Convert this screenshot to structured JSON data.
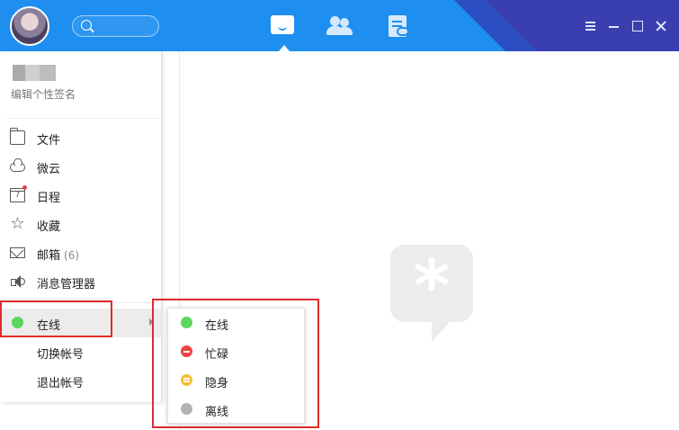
{
  "titlebar": {
    "search_placeholder": "",
    "tabs": [
      {
        "icon": "message-icon",
        "active": true
      },
      {
        "icon": "contacts-icon",
        "active": false
      },
      {
        "icon": "docs-icon",
        "active": false
      }
    ],
    "window_controls": [
      "menu-icon",
      "minimize-icon",
      "maximize-icon",
      "close-icon"
    ]
  },
  "menu": {
    "signature": "编辑个性签名",
    "items": [
      {
        "label": "文件",
        "icon": "folder-icon"
      },
      {
        "label": "微云",
        "icon": "cloud-icon"
      },
      {
        "label": "日程",
        "icon": "calendar-icon",
        "calendar_day": "7",
        "has_badge": true
      },
      {
        "label": "收藏",
        "icon": "star-icon"
      },
      {
        "label": "邮箱",
        "icon": "mail-icon",
        "count": "(6)"
      },
      {
        "label": "消息管理器",
        "icon": "speaker-icon"
      }
    ],
    "status": {
      "label": "在线",
      "color": "#5cd65c"
    },
    "switch_account": "切换帐号",
    "logout": "退出帐号"
  },
  "status_submenu": {
    "options": [
      {
        "label": "在线",
        "color": "#5cd65c"
      },
      {
        "label": "忙碌",
        "color": "#ec4141"
      },
      {
        "label": "隐身",
        "color": "#f5be3b"
      },
      {
        "label": "离线",
        "color": "#b3b3b3"
      }
    ]
  },
  "colors": {
    "titlebar": "#1e8ff0",
    "titlebar_accent": "#2a4ec2",
    "highlight": "#e02b2b"
  }
}
